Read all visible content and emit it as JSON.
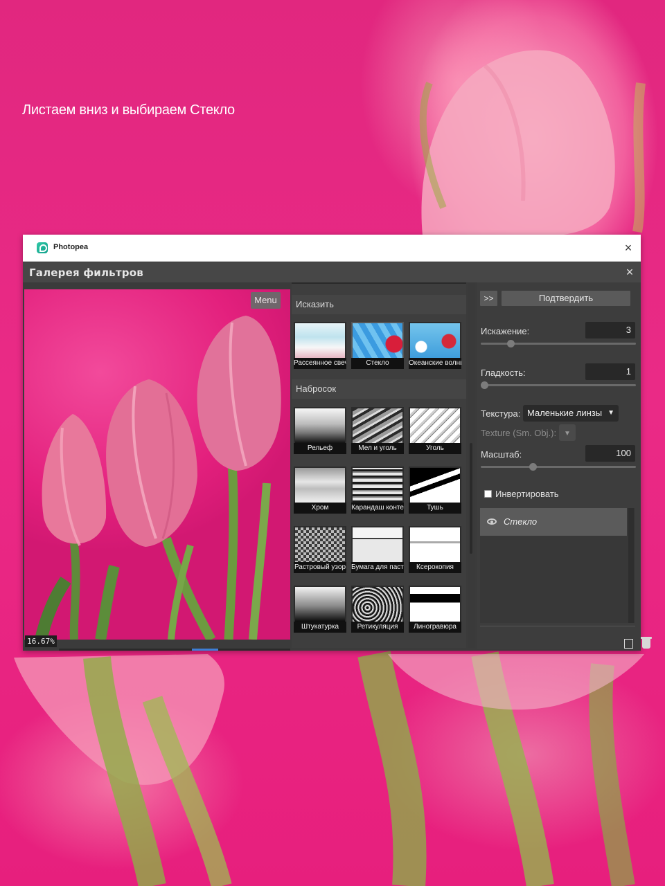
{
  "caption": "Листаем вниз и выбираем Стекло",
  "window": {
    "app_title": "Photopea",
    "close_glyph": "×"
  },
  "dialog": {
    "title": "Галерея фильтров",
    "close_glyph": "×"
  },
  "preview": {
    "menu_label": "Menu",
    "zoom": "16.67%"
  },
  "filters": {
    "categories": [
      {
        "name": "Исказить",
        "items": [
          {
            "label": "Рассеянное свечение",
            "selected": false
          },
          {
            "label": "Стекло",
            "selected": true
          },
          {
            "label": "Океанские волны",
            "selected": false
          }
        ]
      },
      {
        "name": "Набросок",
        "items": [
          {
            "label": "Рельеф",
            "selected": false
          },
          {
            "label": "Мел и уголь",
            "selected": false
          },
          {
            "label": "Уголь",
            "selected": false
          },
          {
            "label": "Хром",
            "selected": false
          },
          {
            "label": "Карандаш конте",
            "selected": false
          },
          {
            "label": "Тушь",
            "selected": false
          },
          {
            "label": "Растровый узор",
            "selected": false
          },
          {
            "label": "Бумага для пастели",
            "selected": false
          },
          {
            "label": "Ксерокопия",
            "selected": false
          },
          {
            "label": "Штукатурка",
            "selected": false
          },
          {
            "label": "Ретикуляция",
            "selected": false
          },
          {
            "label": "Линогравюра",
            "selected": false
          }
        ]
      }
    ]
  },
  "settings": {
    "expand_label": ">>",
    "confirm_label": "Подтвердить",
    "distortion": {
      "label": "Искажение:",
      "value": "3",
      "level": 0.18
    },
    "smoothness": {
      "label": "Гладкость:",
      "value": "1",
      "level": 0.0
    },
    "texture": {
      "label": "Текстура:",
      "value": "Маленькие линзы"
    },
    "texture_smart": {
      "label": "Texture (Sm. Obj.):"
    },
    "scale": {
      "label": "Масштаб:",
      "value": "100",
      "level": 0.33
    },
    "invert": {
      "label": "Инвертировать",
      "checked": false
    },
    "layer": {
      "name": "Стекло"
    }
  },
  "colors": {
    "background": "#e8217f",
    "panel": "#3d3d3d",
    "accent_arrow": "#e23d86",
    "scroll_thumb": "#3d7fd6"
  }
}
